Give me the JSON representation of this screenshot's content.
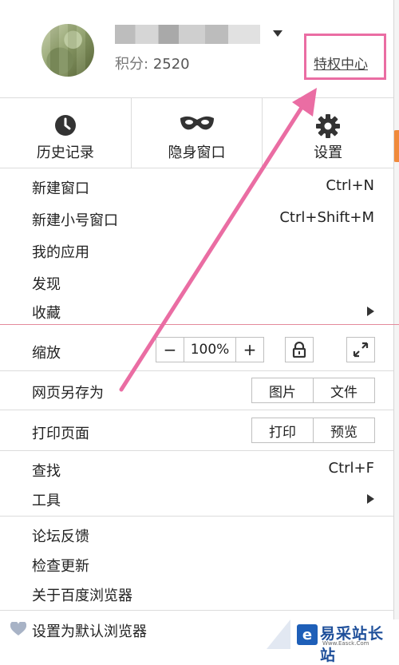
{
  "header": {
    "score_label": "积分:",
    "score_value": "2520",
    "vip_center": "特权中心"
  },
  "tiles": [
    {
      "label": "历史记录",
      "icon": "clock-icon"
    },
    {
      "label": "隐身窗口",
      "icon": "mask-icon"
    },
    {
      "label": "设置",
      "icon": "gear-icon"
    }
  ],
  "menu": {
    "new_window": {
      "label": "新建窗口",
      "shortcut": "Ctrl+N"
    },
    "new_alt_window": {
      "label": "新建小号窗口",
      "shortcut": "Ctrl+Shift+M"
    },
    "my_apps": {
      "label": "我的应用"
    },
    "discover": {
      "label": "发现"
    },
    "favorites": {
      "label": "收藏"
    },
    "zoom": {
      "label": "缩放",
      "minus": "−",
      "value": "100%",
      "plus": "+"
    },
    "save_as": {
      "label": "网页另存为",
      "btn1": "图片",
      "btn2": "文件"
    },
    "print": {
      "label": "打印页面",
      "btn1": "打印",
      "btn2": "预览"
    },
    "find": {
      "label": "查找",
      "shortcut": "Ctrl+F"
    },
    "tools": {
      "label": "工具"
    },
    "feedback": {
      "label": "论坛反馈"
    },
    "check_update": {
      "label": "检查更新"
    },
    "about": {
      "label": "关于百度浏览器"
    },
    "set_default": {
      "label": "设置为默认浏览器"
    }
  },
  "watermark": {
    "badge": "e",
    "text": "易采站长站",
    "sub": "Www.Easck.Com"
  },
  "colors": {
    "highlight": "#ea6da3",
    "divider_red": "#e48a9b"
  }
}
